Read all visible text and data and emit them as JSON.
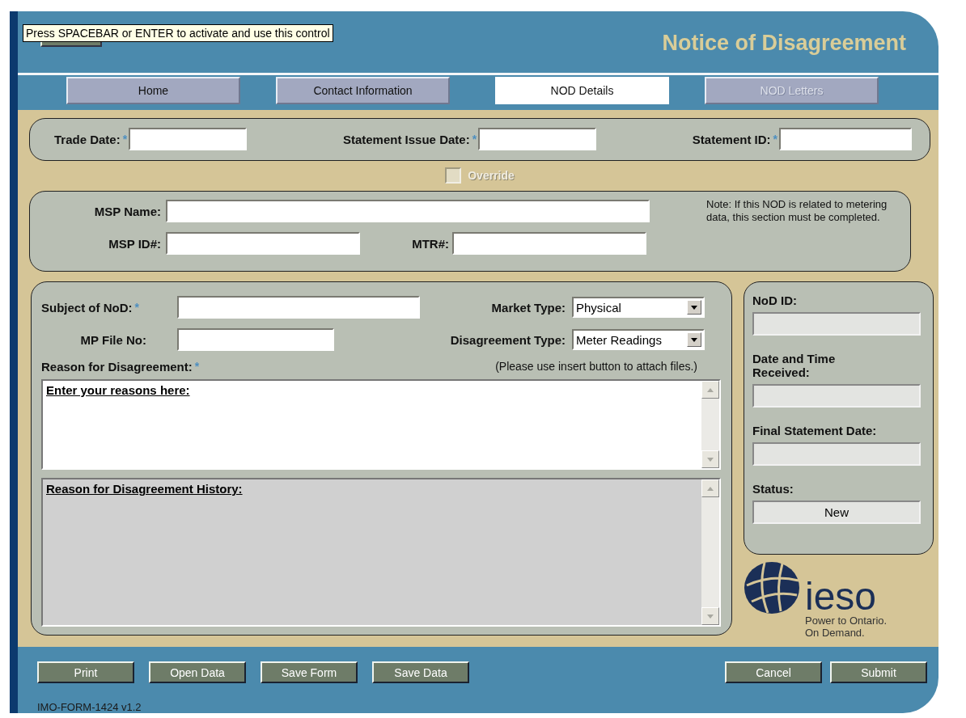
{
  "tooltip": "Press SPACEBAR or ENTER to activate and use this control",
  "title": "Notice of Disagreement",
  "tabs": [
    {
      "label": "Home",
      "selected": false,
      "disabled": false
    },
    {
      "label": "Contact Information",
      "selected": false,
      "disabled": false
    },
    {
      "label": "NOD Details",
      "selected": true,
      "disabled": false
    },
    {
      "label": "NOD Letters",
      "selected": false,
      "disabled": true
    }
  ],
  "statement_section": {
    "fields": [
      {
        "label": "Trade Date:",
        "required_mark": "*"
      },
      {
        "label": "Statement Issue Date:",
        "required_mark": "*"
      },
      {
        "label": "Statement ID:",
        "required_mark": "*"
      }
    ]
  },
  "override": {
    "label": "Override",
    "checked": false,
    "disabled": true
  },
  "msp_section": {
    "msp_name": {
      "label": "MSP Name:"
    },
    "msp_id": {
      "label": "MSP ID#:"
    },
    "mtr": {
      "label": "MTR#:"
    },
    "note": "Note: If this NOD is related to metering data, this section must be completed."
  },
  "nod_section": {
    "subject": {
      "label": "Subject of NoD:",
      "required_mark": "*"
    },
    "mp_file_no": {
      "label": "MP File No:"
    },
    "market_type": {
      "label": "Market Type:",
      "value": "Physical"
    },
    "disagreement_type": {
      "label": "Disagreement Type:",
      "value": "Meter Readings"
    },
    "reason": {
      "label": "Reason for Disagreement:",
      "required_mark": "*",
      "hint": "(Please use insert button to attach files.)",
      "value": "Enter your reasons here:"
    },
    "history": {
      "value": "Reason for Disagreement History:"
    }
  },
  "info_panel": {
    "fields": [
      {
        "label": "NoD ID:"
      },
      {
        "label": "Date and Time Received:"
      },
      {
        "label": "Final Statement Date:"
      },
      {
        "label": "Status:",
        "value": "New"
      }
    ]
  },
  "logo": {
    "wordmark": "ieso",
    "tagline": [
      "Power to Ontario.",
      "On Demand."
    ]
  },
  "footer": {
    "left_buttons": [
      "Print",
      "Open Data",
      "Save Form",
      "Save Data"
    ],
    "right_buttons": [
      "Cancel",
      "Submit"
    ],
    "form_id": "IMO-FORM-1424 v1.2"
  }
}
